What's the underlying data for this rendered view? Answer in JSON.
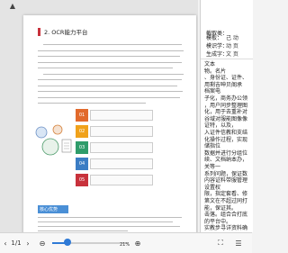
{
  "document": {
    "section_title": "2. OCR能力平台",
    "steps": [
      {
        "num": "01",
        "color": "#e26a2c"
      },
      {
        "num": "02",
        "color": "#f0a21b"
      },
      {
        "num": "03",
        "color": "#2e9c6a"
      },
      {
        "num": "04",
        "color": "#3b7dc4"
      },
      {
        "num": "05",
        "color": "#c8323c"
      }
    ],
    "footer_label": "核心优势"
  },
  "panel": {
    "heading": "截取类：",
    "fields": [
      {
        "label": "模板：",
        "value": "己  动"
      },
      {
        "label": "模识学：",
        "value": "动  页"
      },
      {
        "label": "生成字：",
        "value": "文  页"
      }
    ],
    "lines": [
      "文本",
      "物。名片",
      "、身份证、证件、",
      "用剩吉呻贝阁承",
      "档案电",
      "子化，商务办公领",
      "，用户同步整理图",
      "化，用于去重补对",
      "谷域对服能图像像",
      "证特，以及，",
      "入证件信教和支结",
      "化操作过程，实现",
      "储指位",
      "数据并进行分组位",
      "续、文档纳本办，",
      "关等一",
      "系列问题，保证数",
      "内容证料带服管理",
      "设置权",
      "限，指定套看、修",
      "第文在不超过同打",
      "能，保证其。",
      "击落。组合合打底",
      "的平台中。",
      "实教步寻详资料确"
    ]
  },
  "toolbar": {
    "prev_icon": "‹",
    "page_indicator": "1/1",
    "next_icon": "›",
    "zoom_out_icon": "⊖",
    "zoom_percent": "21%",
    "zoom_fraction": 0.2,
    "zoom_in_icon": "⊕",
    "fit_icon": "⛶",
    "menu_icon": "☰"
  }
}
